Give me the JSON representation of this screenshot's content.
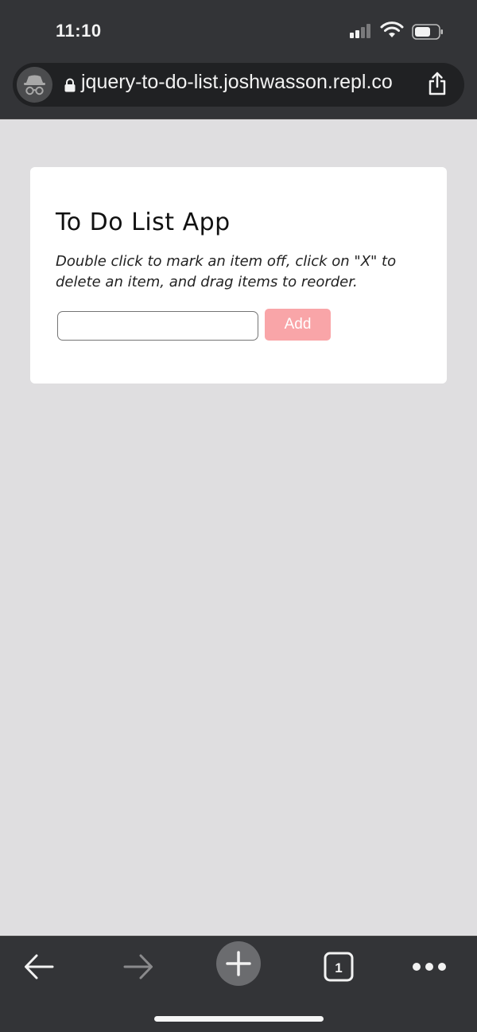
{
  "status_bar": {
    "time": "11:10"
  },
  "browser": {
    "url": "jquery-to-do-list.joshwasson.repl.co",
    "mode": "incognito"
  },
  "toolbar": {
    "tab_count": "1"
  },
  "app": {
    "title": "To Do List App",
    "instructions": "Double click to mark an item off, click on \"X\" to delete an item, and drag items to reorder.",
    "input_value": "",
    "add_label": "Add"
  },
  "colors": {
    "page_bg": "#dfdee0",
    "chrome_bg": "#333437",
    "add_button": "#f9a5a8"
  },
  "icons": [
    "signal-icon",
    "wifi-icon",
    "battery-icon",
    "incognito-icon",
    "lock-icon",
    "share-icon",
    "back-arrow-icon",
    "forward-arrow-icon",
    "new-tab-plus-icon",
    "tab-switcher-icon",
    "more-options-icon"
  ]
}
